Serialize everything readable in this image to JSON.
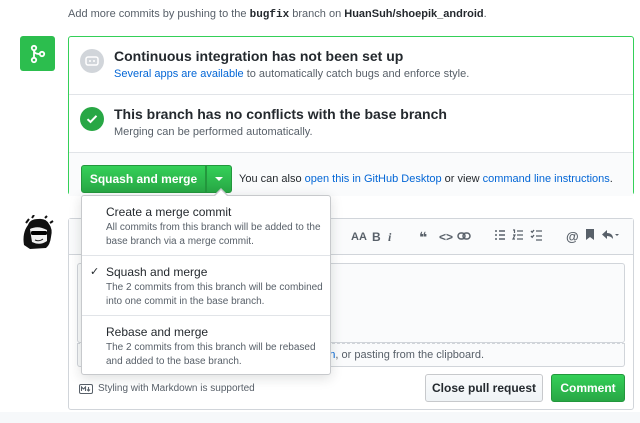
{
  "hint": {
    "prefix": "Add more commits by pushing to the ",
    "branch": "bugfix",
    "middle": " branch on ",
    "repo": "HuanSuh/shoepik_android",
    "suffix": "."
  },
  "ci": {
    "title": "Continuous integration has not been set up",
    "link": "Several apps are available",
    "rest": " to automatically catch bugs and enforce style."
  },
  "conflicts": {
    "title": "This branch has no conflicts with the base branch",
    "sub": "Merging can be performed automatically."
  },
  "merge": {
    "button": "Squash and merge",
    "alt_prefix": "You can also ",
    "alt_link1": "open this in GitHub Desktop",
    "alt_mid": " or view ",
    "alt_link2": "command line instructions",
    "alt_suffix": "."
  },
  "dropdown": {
    "items": [
      {
        "title": "Create a merge commit",
        "desc": "All commits from this branch will be added to the base branch via a merge commit.",
        "checked": false
      },
      {
        "title": "Squash and merge",
        "desc": "The 2 commits from this branch will be combined into one commit in the base branch.",
        "checked": true
      },
      {
        "title": "Rebase and merge",
        "desc": "The 2 commits from this branch will be rebased and added to the base branch.",
        "checked": false
      }
    ],
    "check_glyph": "✓"
  },
  "toolbar": {
    "icons": [
      "AA",
      "B",
      "i",
      "quote-icon",
      "code-icon",
      "link-icon",
      "bullet-list-icon",
      "numbered-list-icon",
      "task-list-icon",
      "mention-icon",
      "bookmark-icon",
      "reply-icon"
    ]
  },
  "comment": {
    "attach_link": "n",
    "attach_rest": ", or pasting from the clipboard.",
    "markdown_note": "Styling with Markdown is supported",
    "close_button": "Close pull request",
    "comment_button": "Comment"
  },
  "colors": {
    "green": "#2cbe4e",
    "link": "#0366d6"
  }
}
